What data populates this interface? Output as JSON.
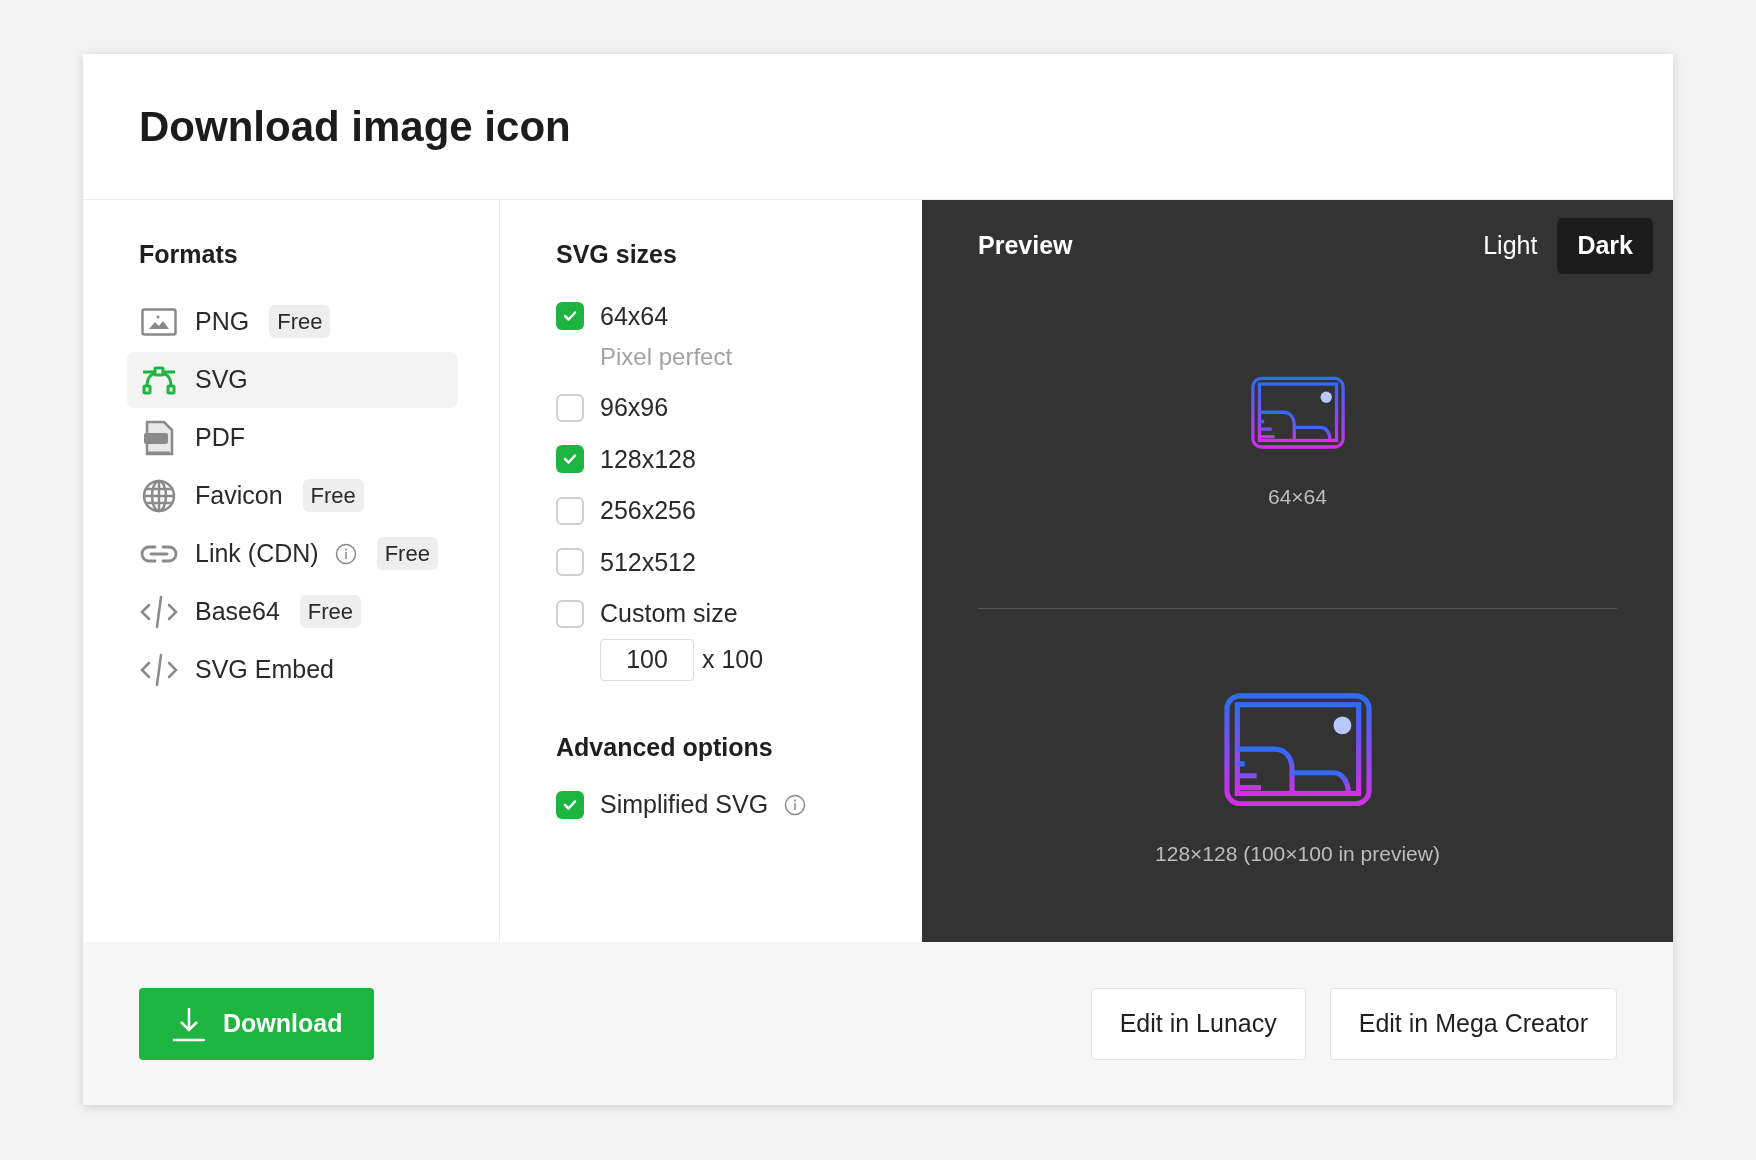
{
  "title": "Download image icon",
  "formats": {
    "heading": "Formats",
    "items": [
      {
        "kind": "image",
        "label": "PNG",
        "badge": "Free",
        "info": false,
        "selected": false
      },
      {
        "kind": "vector",
        "label": "SVG",
        "info": false,
        "selected": true
      },
      {
        "kind": "pdf",
        "label": "PDF",
        "info": false,
        "selected": false
      },
      {
        "kind": "globe",
        "label": "Favicon",
        "badge": "Free",
        "info": false,
        "selected": false
      },
      {
        "kind": "link",
        "label": "Link (CDN)",
        "badge": "Free",
        "info": true,
        "selected": false
      },
      {
        "kind": "code",
        "label": "Base64",
        "badge": "Free",
        "info": false,
        "selected": false
      },
      {
        "kind": "code",
        "label": "SVG Embed",
        "info": false,
        "selected": false
      }
    ]
  },
  "sizes": {
    "heading": "SVG sizes",
    "items": [
      {
        "label": "64x64",
        "note": "Pixel perfect",
        "checked": true
      },
      {
        "label": "96x96",
        "checked": false
      },
      {
        "label": "128x128",
        "checked": true
      },
      {
        "label": "256x256",
        "checked": false
      },
      {
        "label": "512x512",
        "checked": false
      },
      {
        "label": "Custom size",
        "checked": false
      }
    ],
    "custom": {
      "value": "100",
      "suffix": "x 100"
    }
  },
  "advanced": {
    "heading": "Advanced options",
    "items": [
      {
        "label": "Simplified SVG",
        "checked": true,
        "info": true
      }
    ]
  },
  "preview": {
    "heading": "Preview",
    "themes": [
      {
        "label": "Light",
        "selected": false
      },
      {
        "label": "Dark",
        "selected": true
      }
    ],
    "samples": [
      {
        "caption": "64×64",
        "kind": "small"
      },
      {
        "caption": "128×128 (100×100 in preview)",
        "kind": "large"
      }
    ]
  },
  "footer": {
    "download": "Download",
    "buttons": [
      "Edit in Lunacy",
      "Edit in Mega Creator"
    ]
  }
}
